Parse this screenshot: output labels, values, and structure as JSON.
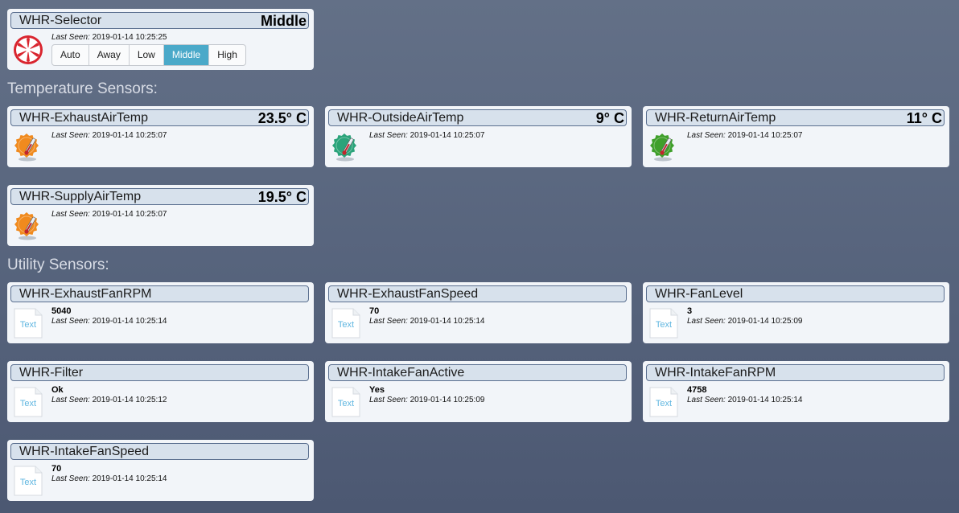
{
  "selector": {
    "name": "WHR-Selector",
    "value": "Middle",
    "last_seen_label": "Last Seen:",
    "last_seen": "2019-01-14 10:25:25",
    "options": [
      "Auto",
      "Away",
      "Low",
      "Middle",
      "High"
    ],
    "selected": "Middle",
    "icon": "fan-icon"
  },
  "temperature_section": {
    "title": "Temperature Sensors:",
    "sensors": [
      {
        "name": "WHR-ExhaustAirTemp",
        "value": "23.5° C",
        "last_seen": "2019-01-14 10:25:07",
        "icon": "thermometer-warm-icon"
      },
      {
        "name": "WHR-OutsideAirTemp",
        "value": "9° C",
        "last_seen": "2019-01-14 10:25:07",
        "icon": "thermometer-cool-icon"
      },
      {
        "name": "WHR-ReturnAirTemp",
        "value": "11° C",
        "last_seen": "2019-01-14 10:25:07",
        "icon": "thermometer-mild-icon"
      },
      {
        "name": "WHR-SupplyAirTemp",
        "value": "19.5° C",
        "last_seen": "2019-01-14 10:25:07",
        "icon": "thermometer-warm-icon"
      }
    ]
  },
  "utility_section": {
    "title": "Utility Sensors:",
    "sensors": [
      {
        "name": "WHR-ExhaustFanRPM",
        "value": "5040",
        "last_seen": "2019-01-14 10:25:14"
      },
      {
        "name": "WHR-ExhaustFanSpeed",
        "value": "70",
        "last_seen": "2019-01-14 10:25:14"
      },
      {
        "name": "WHR-FanLevel",
        "value": "3",
        "last_seen": "2019-01-14 10:25:09"
      },
      {
        "name": "WHR-Filter",
        "value": "Ok",
        "last_seen": "2019-01-14 10:25:12"
      },
      {
        "name": "WHR-IntakeFanActive",
        "value": "Yes",
        "last_seen": "2019-01-14 10:25:09"
      },
      {
        "name": "WHR-IntakeFanRPM",
        "value": "4758",
        "last_seen": "2019-01-14 10:25:14"
      },
      {
        "name": "WHR-IntakeFanSpeed",
        "value": "70",
        "last_seen": "2019-01-14 10:25:14"
      }
    ],
    "icon_label": "Text"
  },
  "last_seen_label": "Last Seen:",
  "colors": {
    "warm": "#f08a1e",
    "cool": "#2aa37a",
    "mild": "#3f9f2a",
    "selected_button": "#4aa9c9",
    "fan": "#d9252f"
  }
}
